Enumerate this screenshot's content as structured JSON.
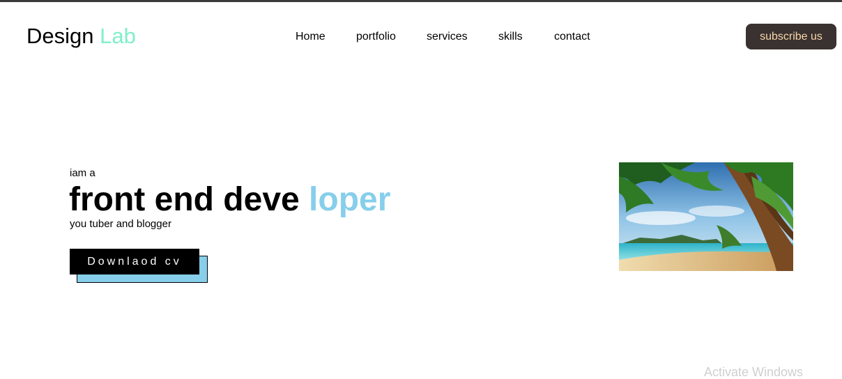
{
  "header": {
    "logo_main": "Design",
    "logo_accent": "Lab",
    "nav": [
      "Home",
      "portfolio",
      "services",
      "skills",
      "contact"
    ],
    "subscribe_label": "subscribe us"
  },
  "hero": {
    "intro": "iam a",
    "title_main": "front end deve",
    "title_accent": "loper",
    "subtitle": "you tuber and blogger",
    "cv_button_label": "Downlaod cv"
  },
  "watermark": "Activate Windows",
  "colors": {
    "logo_accent": "#7ff0c8",
    "title_accent": "#87ceeb",
    "subscribe_bg": "#3a3131",
    "subscribe_text": "#f7d8a8",
    "cv_shadow": "#87ceeb"
  }
}
